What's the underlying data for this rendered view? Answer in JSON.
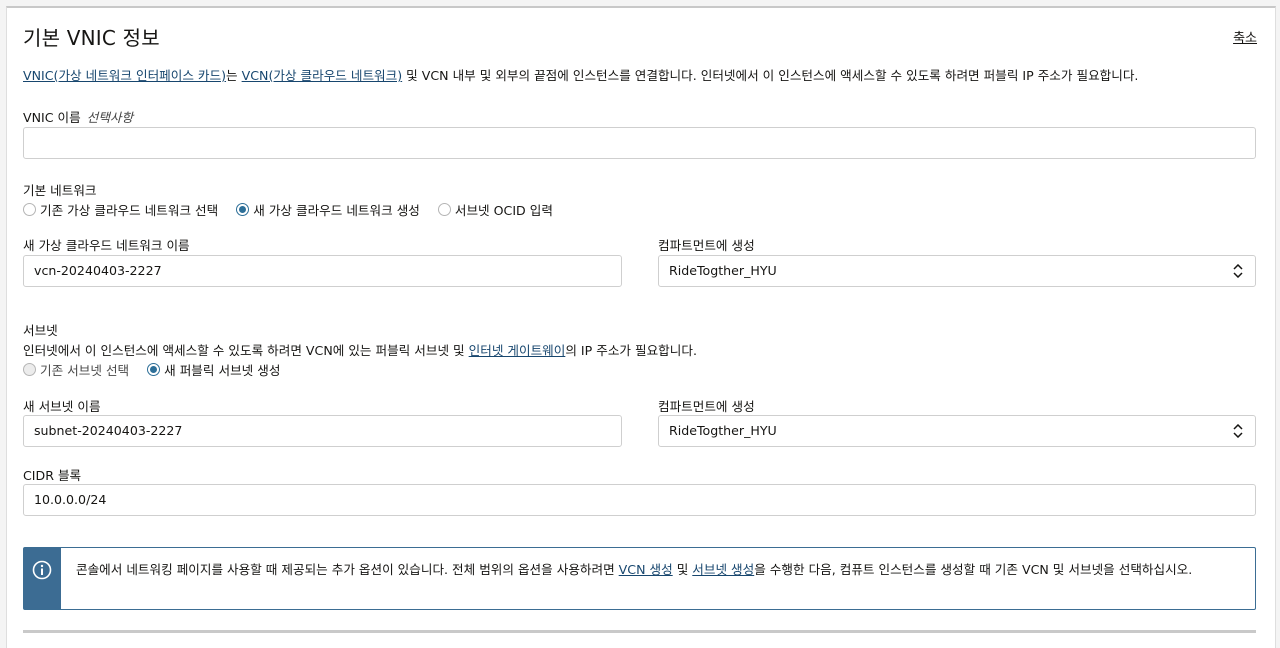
{
  "section": {
    "title": "기본 VNIC 정보",
    "collapse_label": "축소"
  },
  "description": {
    "vnic_link": "VNIC(가상 네트워크 인터페이스 카드)",
    "text1": "는 ",
    "vcn_link": "VCN(가상 클라우드 네트워크)",
    "text2": " 및 VCN 내부 및 외부의 끝점에 인스턴스를 연결합니다. 인터넷에서 이 인스턴스에 액세스할 수 있도록 하려면 퍼블릭 IP 주소가 필요합니다."
  },
  "vnic_name": {
    "label": "VNIC 이름",
    "optional": "선택사항",
    "value": ""
  },
  "primary_network": {
    "label": "기본 네트워크",
    "options": [
      {
        "label": "기존 가상 클라우드 네트워크 선택",
        "selected": false
      },
      {
        "label": "새 가상 클라우드 네트워크 생성",
        "selected": true
      },
      {
        "label": "서브넷 OCID 입력",
        "selected": false
      }
    ],
    "new_vcn_name_label": "새 가상 클라우드 네트워크 이름",
    "new_vcn_name_value": "vcn-20240403-2227",
    "compartment_label": "컴파트먼트에 생성",
    "compartment_value": "RideTogther_HYU"
  },
  "subnet": {
    "label": "서브넷",
    "help_text1": "인터넷에서 이 인스턴스에 액세스할 수 있도록 하려면 VCN에 있는 퍼블릭 서브넷 및 ",
    "help_link": "인터넷 게이트웨이",
    "help_text2": "의 IP 주소가 필요합니다.",
    "options": [
      {
        "label": "기존 서브넷 선택",
        "selected": false
      },
      {
        "label": "새 퍼블릭 서브넷 생성",
        "selected": true
      }
    ],
    "new_subnet_name_label": "새 서브넷 이름",
    "new_subnet_name_value": "subnet-20240403-2227",
    "compartment_label": "컴파트먼트에 생성",
    "compartment_value": "RideTogther_HYU",
    "cidr_label": "CIDR 블록",
    "cidr_value": "10.0.0.0/24"
  },
  "info_banner": {
    "text1": "콘솔에서 네트워킹 페이지를 사용할 때 제공되는 추가 옵션이 있습니다. 전체 범위의 옵션을 사용하려면 ",
    "vcn_link": "VCN 생성",
    "text2": " 및 ",
    "subnet_link": "서브넷 생성",
    "text3": "을 수행한 다음, 컴퓨트 인스턴스를 생성할 때 기존 VCN 및 서브넷을 선택하십시오."
  },
  "colors": {
    "accent": "#2d6f98",
    "link": "#17466e",
    "info_bar": "#3c6c93"
  }
}
